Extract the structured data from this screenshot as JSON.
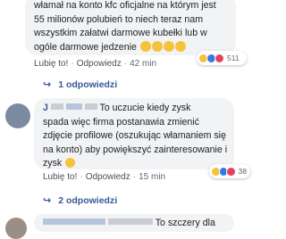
{
  "comment1": {
    "lines": [
      "włamał na konto kfc oficjalne na którym jest",
      "55 milionów polubień to niech teraz nam",
      "wszystkim załatwi darmowe kubełki lub w",
      "ogóle darmowe jedzenie"
    ],
    "like_label": "Lubię to!",
    "reply_label": "Odpowiedz",
    "time": "42 min",
    "reaction_count": "511"
  },
  "replies1": {
    "label": "1 odpowiedzi"
  },
  "comment2": {
    "name_visible": "J",
    "lines_first": "To uczucie kiedy zysk",
    "lines": [
      "spada więc firma postanawia zmienić",
      "zdjęcie profilowe (oszukując włamaniem się",
      "na konto) aby powiększyć zainteresowanie i",
      "zysk"
    ],
    "like_label": "Lubię to!",
    "reply_label": "Odpowiedz",
    "time": "15 min",
    "reaction_count": "38"
  },
  "replies2": {
    "label": "2 odpowiedzi"
  },
  "comment3": {
    "partial_text": "To szczery dla"
  },
  "colors": {
    "link": "#385898",
    "bubble": "#f2f3f5",
    "emoji": "#f7c23b"
  }
}
